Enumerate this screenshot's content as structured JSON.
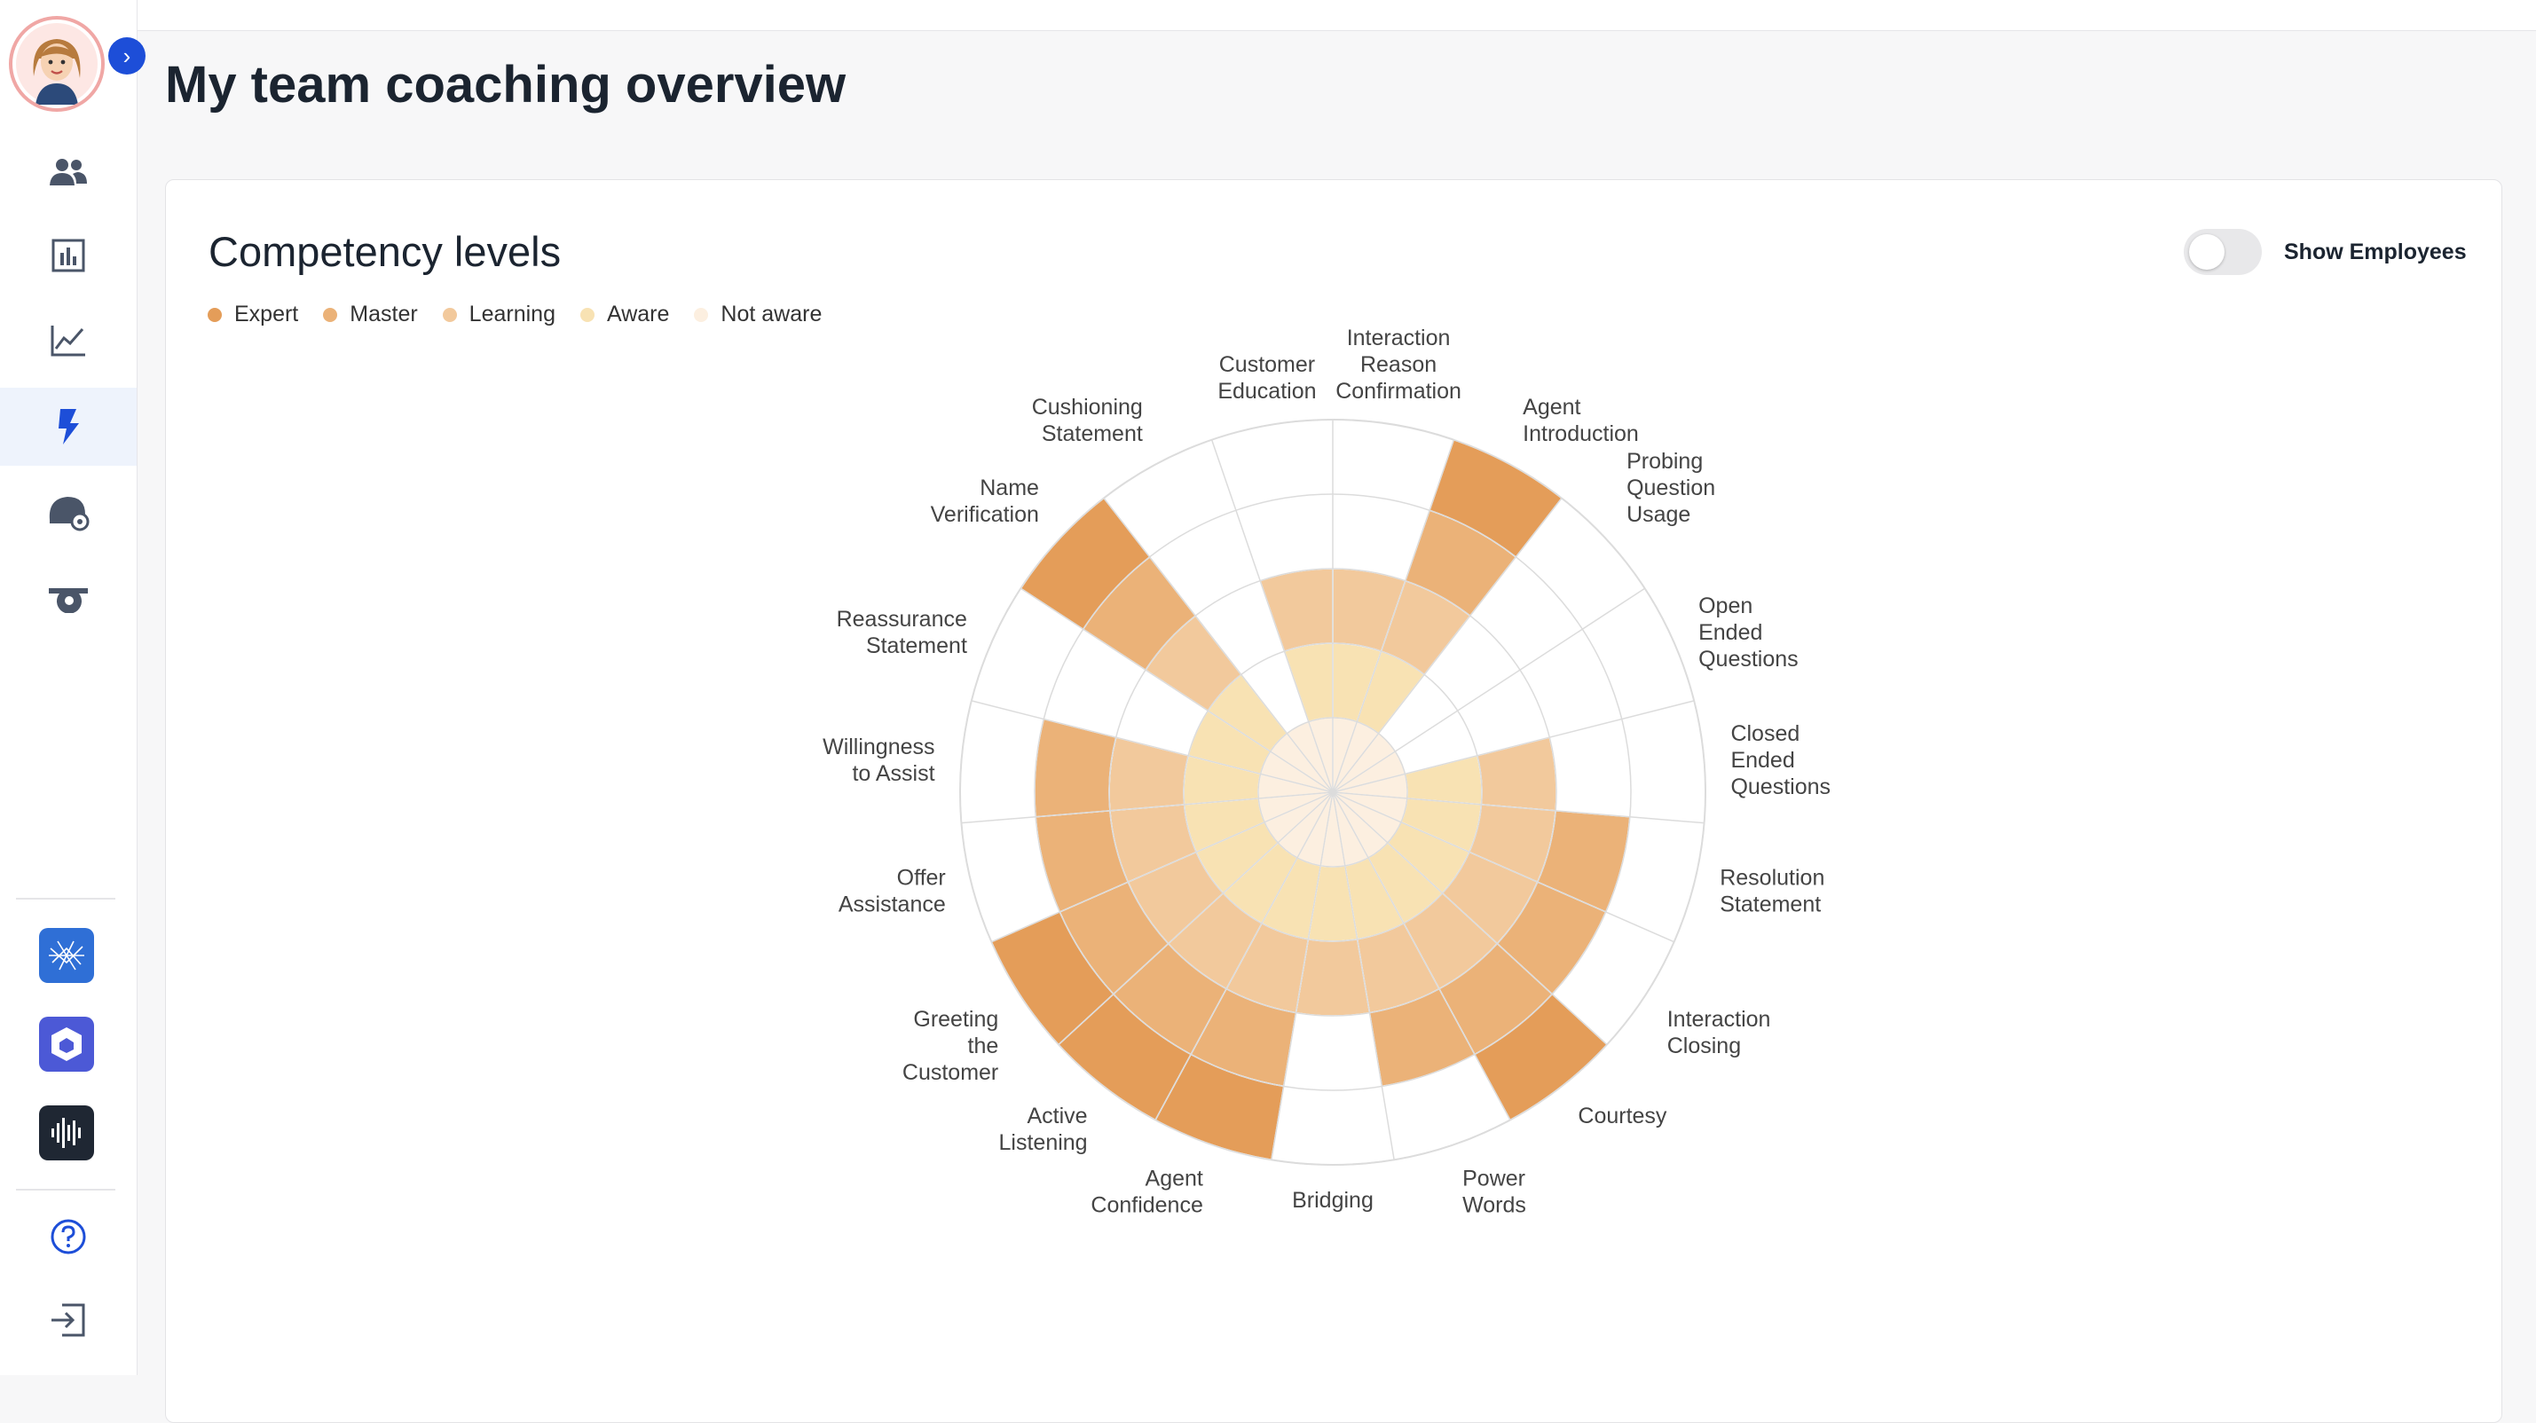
{
  "page": {
    "title": "My team coaching overview"
  },
  "sidebar": {
    "expand_icon": "chevron-right-icon",
    "nav": [
      {
        "name": "team",
        "icon": "people-icon"
      },
      {
        "name": "reports",
        "icon": "bar-chart-icon"
      },
      {
        "name": "trends",
        "icon": "line-chart-icon"
      },
      {
        "name": "coaching",
        "icon": "lightning-icon"
      },
      {
        "name": "agent",
        "icon": "headset-icon"
      },
      {
        "name": "whistle",
        "icon": "whistle-icon"
      }
    ],
    "apps": [
      "network-app-icon",
      "hexagon-app-icon",
      "waveform-app-icon"
    ],
    "help_icon": "help-icon",
    "logout_icon": "logout-icon"
  },
  "card": {
    "title": "Competency levels",
    "toggle_label": "Show Employees",
    "toggle_on": false
  },
  "colors": {
    "expert": "#e49d59",
    "master": "#ebb278",
    "learning": "#f2c99c",
    "aware": "#f8e2b3",
    "not_aware": "#fcefe0",
    "accent": "#1d4ed8"
  },
  "chart_data": {
    "type": "polar-area",
    "levels": [
      "Expert",
      "Master",
      "Learning",
      "Aware",
      "Not aware"
    ],
    "legend": [
      {
        "label": "Expert",
        "color": "#e49d59"
      },
      {
        "label": "Master",
        "color": "#ebb278"
      },
      {
        "label": "Learning",
        "color": "#f2c99c"
      },
      {
        "label": "Aware",
        "color": "#f8e2b3"
      },
      {
        "label": "Not aware",
        "color": "#fcefe0"
      }
    ],
    "categories": [
      {
        "label": [
          "Interaction",
          "Reason",
          "Confirmation"
        ],
        "level": 3
      },
      {
        "label": [
          "Agent",
          "Introduction"
        ],
        "level": 5
      },
      {
        "label": [
          "Probing",
          "Question",
          "Usage"
        ],
        "level": 1
      },
      {
        "label": [
          "Open",
          "Ended",
          "Questions"
        ],
        "level": 1
      },
      {
        "label": [
          "Closed",
          "Ended",
          "Questions"
        ],
        "level": 3
      },
      {
        "label": [
          "Resolution",
          "Statement"
        ],
        "level": 4
      },
      {
        "label": [
          "Interaction",
          "Closing"
        ],
        "level": 4
      },
      {
        "label": [
          "Courtesy"
        ],
        "level": 5
      },
      {
        "label": [
          "Power",
          "Words"
        ],
        "level": 4
      },
      {
        "label": [
          "Bridging"
        ],
        "level": 3
      },
      {
        "label": [
          "Agent",
          "Confidence"
        ],
        "level": 5
      },
      {
        "label": [
          "Active",
          "Listening"
        ],
        "level": 5
      },
      {
        "label": [
          "Greeting",
          "the",
          "Customer"
        ],
        "level": 5
      },
      {
        "label": [
          "Offer",
          "Assistance"
        ],
        "level": 4
      },
      {
        "label": [
          "Willingness",
          "to Assist"
        ],
        "level": 4
      },
      {
        "label": [
          "Reassurance",
          "Statement"
        ],
        "level": 2
      },
      {
        "label": [
          "Name",
          "Verification"
        ],
        "level": 5
      },
      {
        "label": [
          "Cushioning",
          "Statement"
        ],
        "level": 1
      },
      {
        "label": [
          "Customer",
          "Education"
        ],
        "level": 3
      }
    ]
  }
}
